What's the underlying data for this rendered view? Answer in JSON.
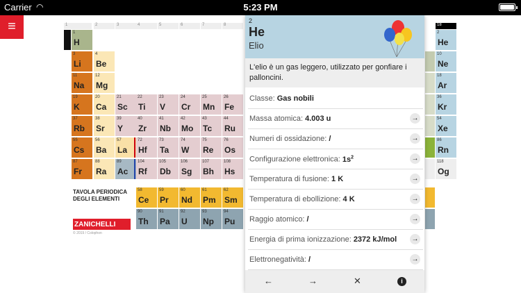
{
  "status_bar": {
    "carrier": "Carrier",
    "time": "5:23 PM"
  },
  "table": {
    "title_line1": "TAVOLA PERIODICA",
    "title_line2": "DEGLI ELEMENTI",
    "publisher": "ZANICHELLI",
    "copyright": "© 2019 / Colophon",
    "group_headers": [
      "1",
      "2",
      "3",
      "4",
      "5",
      "6",
      "7",
      "8",
      "18"
    ],
    "elements": [
      {
        "n": "1",
        "s": "H"
      },
      {
        "n": "3",
        "s": "Li"
      },
      {
        "n": "4",
        "s": "Be"
      },
      {
        "n": "11",
        "s": "Na"
      },
      {
        "n": "12",
        "s": "Mg"
      },
      {
        "n": "19",
        "s": "K"
      },
      {
        "n": "20",
        "s": "Ca"
      },
      {
        "n": "21",
        "s": "Sc"
      },
      {
        "n": "22",
        "s": "Ti"
      },
      {
        "n": "23",
        "s": "V"
      },
      {
        "n": "24",
        "s": "Cr"
      },
      {
        "n": "25",
        "s": "Mn"
      },
      {
        "n": "26",
        "s": "Fe"
      },
      {
        "n": "37",
        "s": "Rb"
      },
      {
        "n": "38",
        "s": "Sr"
      },
      {
        "n": "39",
        "s": "Y"
      },
      {
        "n": "40",
        "s": "Zr"
      },
      {
        "n": "41",
        "s": "Nb"
      },
      {
        "n": "42",
        "s": "Mo"
      },
      {
        "n": "43",
        "s": "Tc"
      },
      {
        "n": "44",
        "s": "Ru"
      },
      {
        "n": "55",
        "s": "Cs"
      },
      {
        "n": "56",
        "s": "Ba"
      },
      {
        "n": "57",
        "s": "La"
      },
      {
        "n": "72",
        "s": "Hf"
      },
      {
        "n": "73",
        "s": "Ta"
      },
      {
        "n": "74",
        "s": "W"
      },
      {
        "n": "75",
        "s": "Re"
      },
      {
        "n": "76",
        "s": "Os"
      },
      {
        "n": "87",
        "s": "Fr"
      },
      {
        "n": "88",
        "s": "Ra"
      },
      {
        "n": "89",
        "s": "Ac"
      },
      {
        "n": "104",
        "s": "Rf"
      },
      {
        "n": "105",
        "s": "Db"
      },
      {
        "n": "106",
        "s": "Sg"
      },
      {
        "n": "107",
        "s": "Bh"
      },
      {
        "n": "108",
        "s": "Hs"
      },
      {
        "n": "58",
        "s": "Ce"
      },
      {
        "n": "59",
        "s": "Pr"
      },
      {
        "n": "60",
        "s": "Nd"
      },
      {
        "n": "61",
        "s": "Pm"
      },
      {
        "n": "62",
        "s": "Sm"
      },
      {
        "n": "90",
        "s": "Th"
      },
      {
        "n": "91",
        "s": "Pa"
      },
      {
        "n": "92",
        "s": "U"
      },
      {
        "n": "93",
        "s": "Np"
      },
      {
        "n": "94",
        "s": "Pu"
      },
      {
        "n": "2",
        "s": "He"
      },
      {
        "n": "10",
        "s": "Ne"
      },
      {
        "n": "18",
        "s": "Ar"
      },
      {
        "n": "36",
        "s": "Kr"
      },
      {
        "n": "54",
        "s": "Xe"
      },
      {
        "n": "86",
        "s": "Rn"
      },
      {
        "n": "118",
        "s": "Og"
      }
    ]
  },
  "panel": {
    "number": "2",
    "symbol": "He",
    "name": "Elio",
    "description": "L'elio è un gas leggero, utilizzato per gonfiare i palloncini.",
    "rows": [
      {
        "label": "Classe:",
        "value": "Gas nobili"
      },
      {
        "label": "Massa atomica:",
        "value": "4.003 u"
      },
      {
        "label": "Numeri di ossidazione:",
        "value": "/"
      },
      {
        "label": "Configurazione elettronica:",
        "value": "1s",
        "sup": "2"
      },
      {
        "label": "Temperatura di fusione:",
        "value": "1 K"
      },
      {
        "label": "Temperatura di ebollizione:",
        "value": "4 K"
      },
      {
        "label": "Raggio atomico:",
        "value": "/"
      },
      {
        "label": "Energia di prima ionizzazione:",
        "value": "2372 kJ/mol"
      },
      {
        "label": "Elettronegatività:",
        "value": "/"
      }
    ],
    "footer": {
      "back": "←",
      "forward": "→",
      "close": "✕",
      "info": "i"
    }
  }
}
